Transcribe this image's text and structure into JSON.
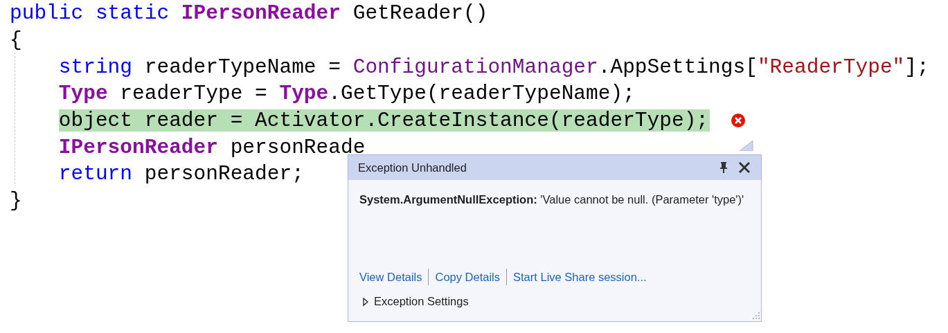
{
  "code_lines": [
    {
      "highlighted": false,
      "tokens": [
        {
          "text": "public static ",
          "kind": "keyword"
        },
        {
          "text": "IPersonReader",
          "kind": "type"
        },
        {
          "text": " GetReader()",
          "kind": "plain"
        }
      ]
    },
    {
      "highlighted": false,
      "tokens": [
        {
          "text": "{",
          "kind": "plain"
        }
      ]
    },
    {
      "highlighted": false,
      "tokens": [
        {
          "text": "    string",
          "kind": "keyword"
        },
        {
          "text": " readerTypeName = ",
          "kind": "plain"
        },
        {
          "text": "ConfigurationManager",
          "kind": "class"
        },
        {
          "text": ".AppSettings[",
          "kind": "plain"
        },
        {
          "text": "\"ReaderType\"",
          "kind": "string"
        },
        {
          "text": "];",
          "kind": "plain"
        }
      ]
    },
    {
      "highlighted": false,
      "tokens": [
        {
          "text": "    Type",
          "kind": "type"
        },
        {
          "text": " readerType = ",
          "kind": "plain"
        },
        {
          "text": "Type",
          "kind": "type"
        },
        {
          "text": ".GetType(readerTypeName);",
          "kind": "plain"
        }
      ]
    },
    {
      "highlighted": true,
      "error": true,
      "tokens": [
        {
          "text": "    object reader = Activator.CreateInstance(readerType);",
          "kind": "plain"
        }
      ]
    },
    {
      "highlighted": false,
      "tokens": [
        {
          "text": "    IPersonReader",
          "kind": "type"
        },
        {
          "text": " personReade",
          "kind": "plain"
        }
      ]
    },
    {
      "highlighted": false,
      "tokens": [
        {
          "text": "    return",
          "kind": "keyword"
        },
        {
          "text": " personReader;",
          "kind": "plain"
        }
      ]
    },
    {
      "highlighted": false,
      "tokens": [
        {
          "text": "}",
          "kind": "plain"
        }
      ]
    }
  ],
  "exception_popup": {
    "title": "Exception Unhandled",
    "exception_type": "System.ArgumentNullException:",
    "message": "'Value cannot be null. (Parameter 'type')'",
    "links": [
      "View Details",
      "Copy Details",
      "Start Live Share session..."
    ],
    "settings": {
      "label": "Exception Settings",
      "expanded": false
    }
  }
}
